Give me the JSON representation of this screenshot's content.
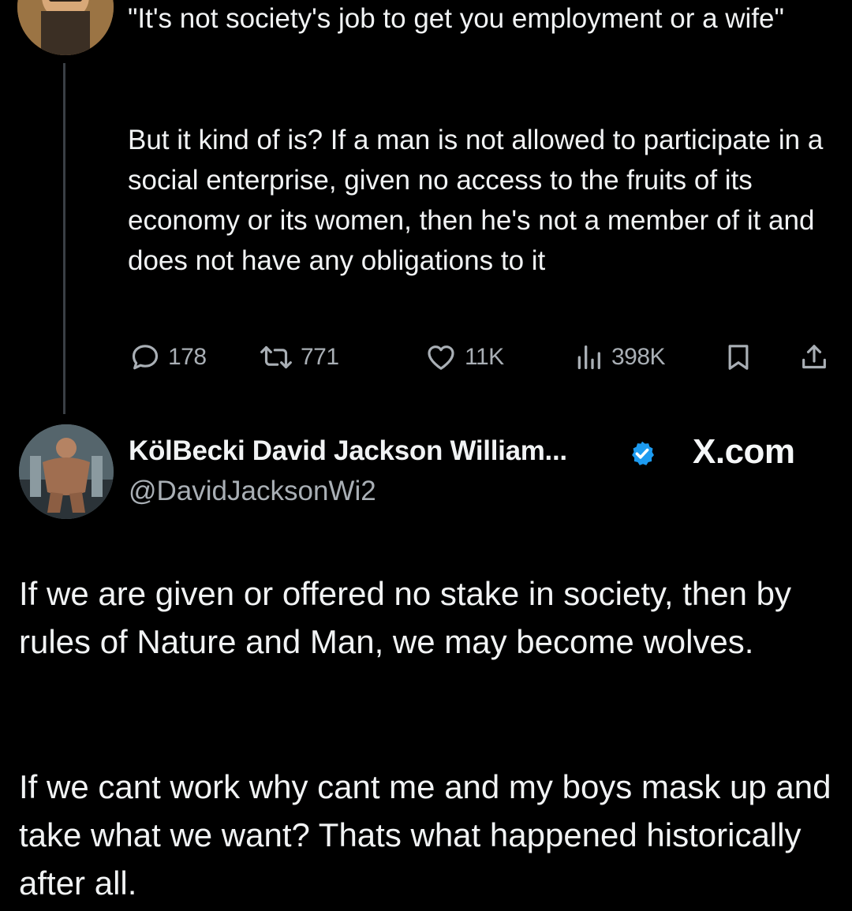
{
  "parent_tweet": {
    "quote": "\"It's not society's job to get you employment or a wife\"",
    "body": "But it kind of is? If a man is not allowed to participate in a social enterprise, given no access to the fruits of its economy or its women, then he's not a member of it and does not have any obligations to it",
    "metrics": {
      "replies": "178",
      "reposts": "771",
      "likes": "11K",
      "views": "398K"
    }
  },
  "reply_tweet": {
    "display_name": "KölBecki David Jackson William...",
    "handle": "@DavidJacksonWi2",
    "verified": true,
    "source_label": "X.com",
    "paragraph_1": "If we are given or offered no stake in society, then by rules of Nature and Man, we may become wolves.",
    "paragraph_2": "If we cant work why cant me and my boys mask up and take what we want? Thats what happened historically after all."
  },
  "icons": {
    "reply": "speech-bubble-icon",
    "repost": "repost-arrows-icon",
    "like": "heart-icon",
    "views": "bar-chart-icon",
    "bookmark": "bookmark-icon",
    "share": "share-upload-icon",
    "verified": "verified-badge-icon"
  },
  "colors": {
    "background": "#000000",
    "text": "#f1f3f4",
    "muted": "#a9afb5",
    "verified_blue": "#1d9bf0",
    "thread_line": "#3a3f45"
  }
}
